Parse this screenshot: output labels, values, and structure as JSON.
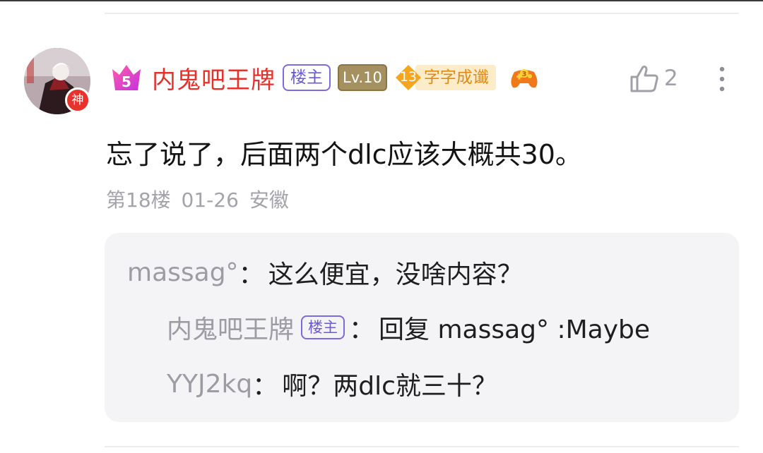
{
  "post": {
    "avatar_badge": "神",
    "username": "内鬼吧王牌",
    "owner_tag": "楼主",
    "level": "Lv.10",
    "title_level": "13",
    "title_text": "字字成谶",
    "like_count": "2",
    "content": "忘了说了，后面两个dlc应该大概共30。",
    "floor": "第18楼",
    "date": "01-26",
    "location": "安徽"
  },
  "replies": [
    {
      "name": "massag°",
      "sep": "：",
      "text": "这么便宜，没啥内容？"
    },
    {
      "name": "内鬼吧王牌",
      "tag": "楼主",
      "sep": "：",
      "text": "回复 massag° :Maybe"
    },
    {
      "name": "YYJ2kq",
      "sep": "：",
      "text": "啊？两dlc就三十？"
    }
  ],
  "colors": {
    "username": "#e4322b",
    "owner_tag": "#6a5ad8",
    "title_tag": "#e08a13",
    "reply_bg": "#f4f4f7"
  },
  "icons": [
    "crown-icon",
    "gamepad-icon",
    "thumbs-up-icon",
    "more-vertical-icon"
  ]
}
